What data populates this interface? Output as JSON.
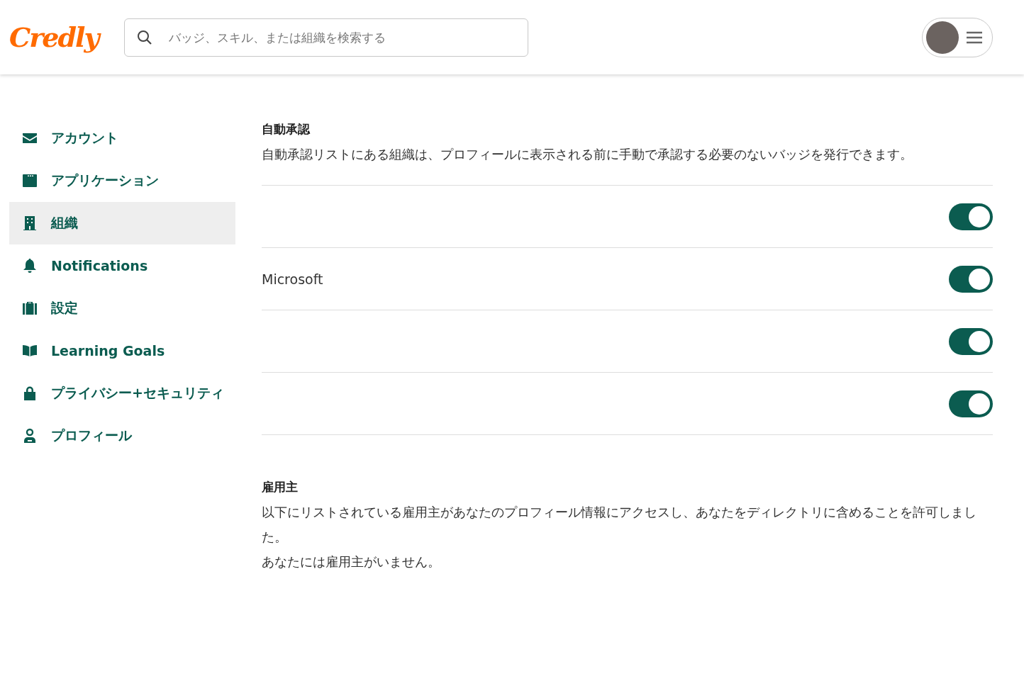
{
  "header": {
    "logo": "Credly",
    "search": {
      "placeholder": "バッジ、スキル、または組織を検索する"
    }
  },
  "sidebar": {
    "items": [
      {
        "label": "アカウント",
        "selected": false
      },
      {
        "label": "アプリケーション",
        "selected": false
      },
      {
        "label": "組織",
        "selected": true
      },
      {
        "label": "Notifications",
        "selected": false
      },
      {
        "label": "設定",
        "selected": false
      },
      {
        "label": "Learning Goals",
        "selected": false
      },
      {
        "label": "プライバシー+セキュリティ",
        "selected": false
      },
      {
        "label": "プロフィール",
        "selected": false
      }
    ]
  },
  "auto_approval": {
    "title": "自動承認",
    "description": "自動承認リストにある組織は、プロフィールに表示される前に手動で承認する必要のないバッジを発行できます。",
    "rows": [
      {
        "on": true
      },
      {
        "name": "Microsoft",
        "on": true
      },
      {
        "on": true
      },
      {
        "on": true
      }
    ]
  },
  "employers": {
    "title": "雇用主",
    "description": "以下にリストされている雇用主があなたのプロフィール情報にアクセスし、あなたをディレクトリに含めることを許可しました。",
    "empty_message": "あなたには雇用主がいません。"
  }
}
